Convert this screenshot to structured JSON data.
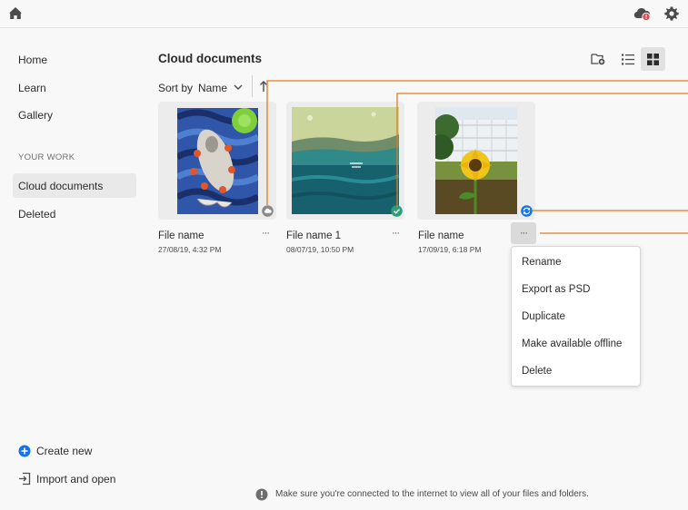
{
  "topbar": {
    "home_icon": "home-icon",
    "cloud_icon": "cloud-alert-icon",
    "cloud_badge": "!",
    "settings_icon": "gear-icon"
  },
  "sidebar": {
    "items": [
      {
        "label": "Home"
      },
      {
        "label": "Learn"
      },
      {
        "label": "Gallery"
      }
    ],
    "section_title": "YOUR WORK",
    "work_items": [
      {
        "label": "Cloud documents",
        "active": true
      },
      {
        "label": "Deleted"
      }
    ],
    "create_new": "Create new",
    "import_open": "Import and open"
  },
  "main": {
    "title": "Cloud documents",
    "toolbar": {
      "new_folder_icon": "new-folder-icon",
      "list_view_icon": "list-view-icon",
      "grid_view_icon": "grid-view-icon",
      "active_view": "grid"
    },
    "sort": {
      "label": "Sort by",
      "value": "Name"
    },
    "cards": [
      {
        "name": "File name",
        "date": "27/08/19, 4:32 PM",
        "status": "cloud-only",
        "more": "···"
      },
      {
        "name": "File name 1",
        "date": "08/07/19, 10:50 PM",
        "status": "available-offline",
        "more": "···"
      },
      {
        "name": "File name",
        "date": "17/09/19, 6:18 PM",
        "status": "syncing",
        "more": "···"
      }
    ],
    "context_menu": [
      "Rename",
      "Export as PSD",
      "Duplicate",
      "Make available offline",
      "Delete"
    ]
  },
  "notice": {
    "icon": "alert-icon",
    "text": "Make sure you're connected to the internet to view all of your files and folders."
  },
  "colors": {
    "accent": "#1473e6",
    "callout": "#e07b1f",
    "success": "#2d9d78",
    "alert": "#e34850"
  }
}
